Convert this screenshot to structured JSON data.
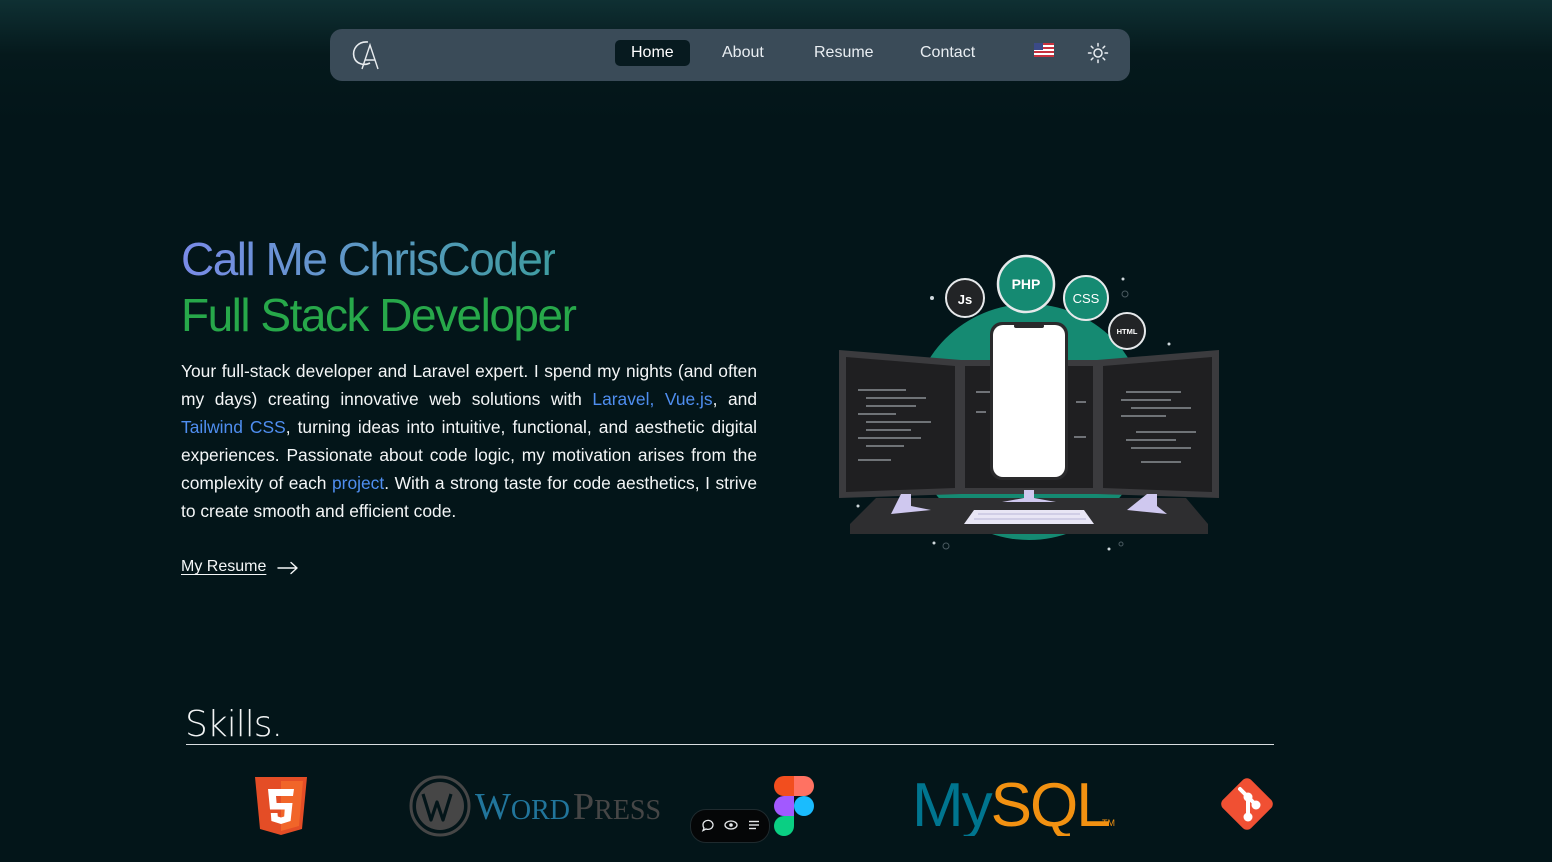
{
  "nav": {
    "items": [
      {
        "label": "Home",
        "active": true
      },
      {
        "label": "About",
        "active": false
      },
      {
        "label": "Resume",
        "active": false
      },
      {
        "label": "Contact",
        "active": false
      }
    ],
    "language_icon": "us-flag-icon",
    "theme_icon": "sun-icon"
  },
  "hero": {
    "line1": "Call Me ChrisCoder",
    "line2": "Full Stack Developer",
    "intro": {
      "p1": "Your full-stack developer and Laravel expert. I spend my nights (and often my days) creating innovative web solutions with ",
      "link1": "Laravel, Vue.js",
      "p2": ", and ",
      "link2": "Tailwind CSS",
      "p3": ", turning ideas into intuitive, functional, and aesthetic digital experiences. Passionate about code logic, my motivation arises from the complexity of each ",
      "link3": "project",
      "p4": ". With a strong taste for code aesthetics, I strive to create smooth and efficient code."
    },
    "cta": "My Resume",
    "bubbles": {
      "js": "Js",
      "php": "PHP",
      "css": "CSS",
      "html": "HTML"
    }
  },
  "skills": {
    "title": "Skills.",
    "items": [
      {
        "icon": "html5-icon"
      },
      {
        "icon": "wordpress-icon",
        "label_big_w": "W",
        "label_rest": "ORD",
        "label_p": "P",
        "label_rest2": "RESS"
      },
      {
        "icon": "figma-icon"
      },
      {
        "icon": "mysql-icon",
        "label_my": "My",
        "label_sql": "SQL",
        "label_tm": "TM"
      },
      {
        "icon": "git-icon"
      }
    ]
  },
  "colors": {
    "background": "#031519",
    "nav": "#3a4b58",
    "accent_green": "#27a84a",
    "link_blue": "#4f8ef0",
    "teal": "#158a72"
  }
}
